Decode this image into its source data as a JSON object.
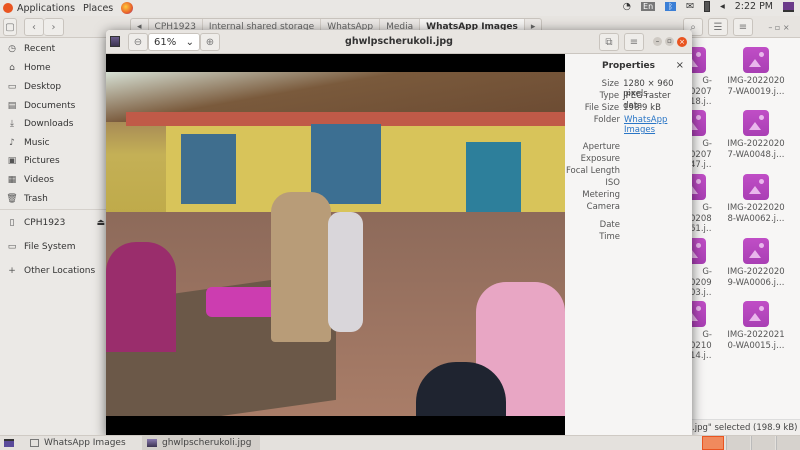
{
  "topbar": {
    "applications": "Applications",
    "places": "Places",
    "keyboard": "En",
    "time": "2:22 PM",
    "icons": [
      "wifi-icon",
      "keyboard-icon",
      "bluetooth-icon",
      "mail-icon",
      "battery-icon",
      "volume-icon",
      "power-icon"
    ]
  },
  "nautilus": {
    "breadcrumbs": [
      "CPH1923",
      "Internal shared storage",
      "WhatsApp",
      "Media",
      "WhatsApp Images"
    ],
    "sidebar": [
      {
        "label": "Recent",
        "icon": "clock-icon"
      },
      {
        "label": "Home",
        "icon": "home-icon"
      },
      {
        "label": "Desktop",
        "icon": "desktop-icon"
      },
      {
        "label": "Documents",
        "icon": "documents-icon"
      },
      {
        "label": "Downloads",
        "icon": "download-icon"
      },
      {
        "label": "Music",
        "icon": "music-icon"
      },
      {
        "label": "Pictures",
        "icon": "pictures-icon"
      },
      {
        "label": "Videos",
        "icon": "videos-icon"
      },
      {
        "label": "Trash",
        "icon": "trash-icon"
      },
      {
        "label": "CPH1923",
        "icon": "phone-icon"
      },
      {
        "label": "File System",
        "icon": "drive-icon"
      },
      {
        "label": "Other Locations",
        "icon": "plus-icon"
      }
    ],
    "files": [
      {
        "name": "IMG-20220207-WA0019.j…"
      },
      {
        "name": "IMG-20220207-WA0048.j…"
      },
      {
        "name": "IMG-20220208-WA0062.j…"
      },
      {
        "name": "IMG-20220209-WA0006.j…"
      },
      {
        "name": "IMG-20220210-WA0015.j…"
      }
    ],
    "partial_files": [
      {
        "l1": "G-",
        "l2": "0207-",
        "l3": "18.j…"
      },
      {
        "l1": "G-",
        "l2": "0207-",
        "l3": "47.j…"
      },
      {
        "l1": "G-",
        "l2": "0208-",
        "l3": "61.j…"
      },
      {
        "l1": "G-",
        "l2": "0209-",
        "l3": "03.j…"
      },
      {
        "l1": "G-",
        "l2": "0210-",
        "l3": "14.j…"
      }
    ],
    "status": ".jpg\" selected  (198.9 kB)"
  },
  "viewer": {
    "title": "ghwlpscherukoli.jpg",
    "zoom": "61%",
    "properties": {
      "heading": "Properties",
      "close": "×",
      "rows": [
        {
          "k": "Size",
          "v": "1280 × 960 pixels"
        },
        {
          "k": "Type",
          "v": "JPEG raster data"
        },
        {
          "k": "File Size",
          "v": "198.9 kB"
        },
        {
          "k": "Folder",
          "v": "WhatsApp Images"
        }
      ],
      "exif": [
        "Aperture",
        "Exposure",
        "Focal Length",
        "ISO",
        "Metering",
        "Camera"
      ],
      "date": [
        "Date",
        "Time"
      ]
    }
  },
  "taskbar": {
    "items": [
      "WhatsApp Images",
      "ghwlpscherukoli.jpg"
    ]
  },
  "colors": {
    "accent": "#e95420",
    "folder_link": "#2a76c6",
    "thumb": "#b945bf"
  }
}
